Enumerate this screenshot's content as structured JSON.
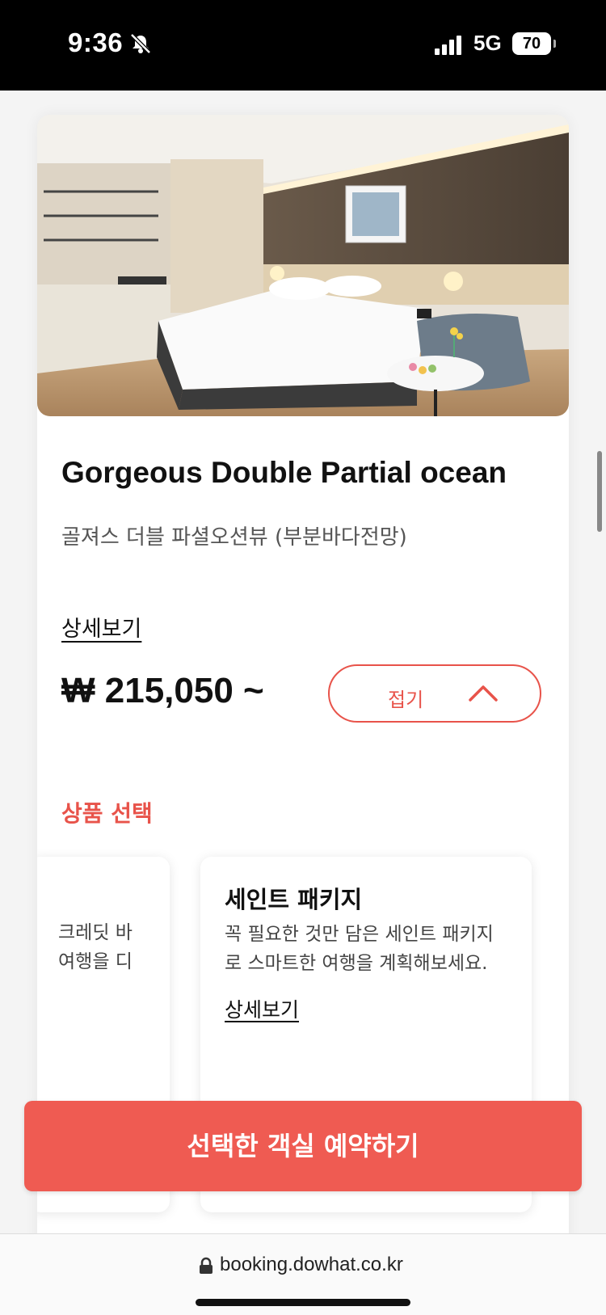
{
  "status_bar": {
    "time": "9:36",
    "network": "5G",
    "battery": "70"
  },
  "room": {
    "title": "Gorgeous Double Partial ocean",
    "subtitle": "골져스 더블 파셜오션뷰 (부분바다전망)",
    "detail_link": "상세보기",
    "price": "₩ 215,050 ~",
    "collapse_label": "접기"
  },
  "products": {
    "section_label": "상품 선택",
    "partial_card": {
      "lines": [
        "크레딧 바",
        "여행을 디"
      ]
    },
    "package": {
      "title": "세인트 패키지",
      "desc_lines": [
        "꼭 필요한 것만 담은 세인트 패키지",
        "로 스마트한 여행을 계획해보세요."
      ],
      "detail_link": "상세보기"
    }
  },
  "cta": {
    "book_label": "선택한 객실 예약하기"
  },
  "browser": {
    "url": "booking.dowhat.co.kr"
  },
  "colors": {
    "accent": "#e8534a",
    "cta_bg": "#ef5b52"
  }
}
